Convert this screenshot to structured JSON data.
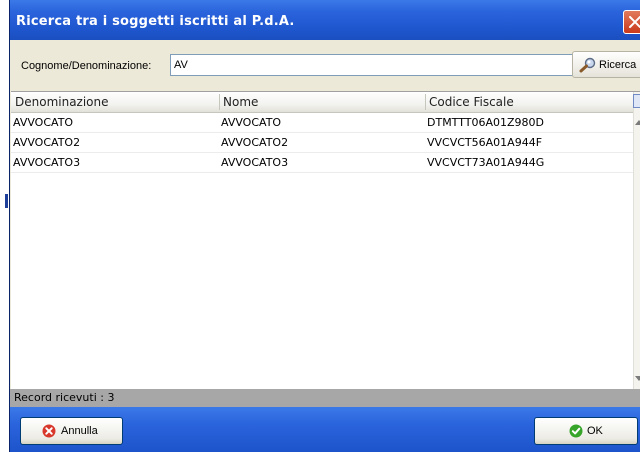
{
  "window": {
    "title": "Ricerca tra i soggetti iscritti al P.d.A."
  },
  "search": {
    "label": "Cognome/Denominazione:",
    "value": "AV",
    "button_label": "Ricerca"
  },
  "table": {
    "headers": [
      "Denominazione",
      "Nome",
      "Codice Fiscale"
    ],
    "rows": [
      [
        "AVVOCATO",
        "AVVOCATO",
        "DTMTTT06A01Z980D"
      ],
      [
        "AVVOCATO2",
        "AVVOCATO2",
        "VVCVCT56A01A944F"
      ],
      [
        "AVVOCATO3",
        "AVVOCATO3",
        "VVCVCT73A01A944G"
      ]
    ]
  },
  "status": {
    "text": "Record ricevuti : 3"
  },
  "buttons": {
    "cancel_label": "Annulla",
    "ok_label": "OK"
  },
  "colors": {
    "titlebar": "#2a63dc",
    "close": "#c9391a",
    "cancel_icon": "#d8382b",
    "ok_icon": "#37a42a",
    "status_bar": "#a7a7a7"
  },
  "icons": {
    "close": "close-icon",
    "search": "magnifier-icon",
    "cancel": "cancel-icon",
    "ok": "check-icon"
  }
}
